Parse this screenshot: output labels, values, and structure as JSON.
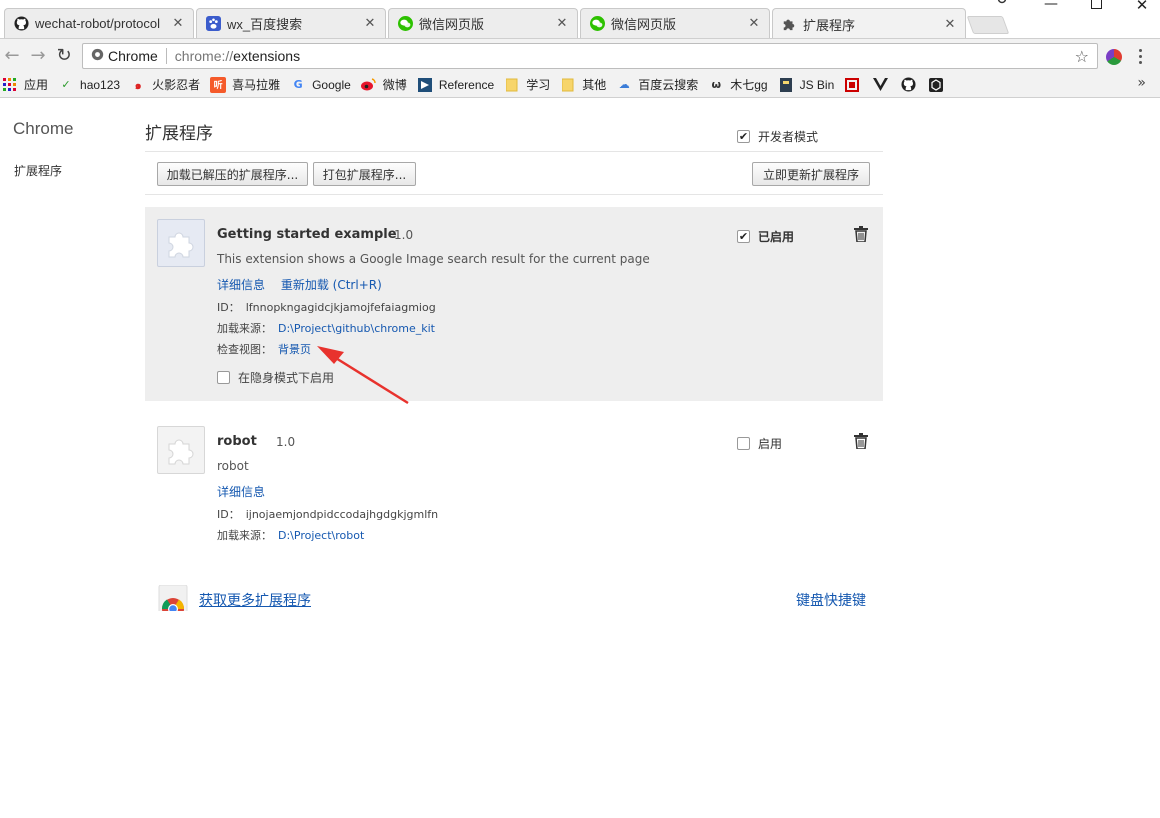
{
  "tabs": [
    {
      "title": "wechat-robot/protocol",
      "icon": "github-icon"
    },
    {
      "title": "wx_百度搜索",
      "icon": "baidu-paw-icon"
    },
    {
      "title": "微信网页版",
      "icon": "wechat-icon"
    },
    {
      "title": "微信网页版",
      "icon": "wechat-icon"
    },
    {
      "title": "扩展程序",
      "icon": "puzzle-icon"
    }
  ],
  "toolbar": {
    "site": "Chrome",
    "url_scheme": "chrome://",
    "url_path": "extensions"
  },
  "bookmarks": [
    {
      "label": "应用",
      "icon": "apps-grid-icon"
    },
    {
      "label": "hao123",
      "icon": "hao123-icon"
    },
    {
      "label": "火影忍者",
      "icon": "naruto-swirl-icon"
    },
    {
      "label": "喜马拉雅",
      "icon": "ximalaya-icon"
    },
    {
      "label": "Google",
      "icon": "google-icon"
    },
    {
      "label": "微博",
      "icon": "weibo-icon"
    },
    {
      "label": "Reference",
      "icon": "reference-icon"
    },
    {
      "label": "学习",
      "icon": "folder-icon"
    },
    {
      "label": "其他",
      "icon": "folder-icon"
    },
    {
      "label": "百度云搜索",
      "icon": "baidu-cloud-icon"
    },
    {
      "label": "木七gg",
      "icon": "muqi-icon"
    },
    {
      "label": "JS Bin",
      "icon": "jsbin-icon"
    },
    {
      "label": "",
      "icon": "red-seal-icon"
    },
    {
      "label": "",
      "icon": "vue-icon"
    },
    {
      "label": "",
      "icon": "github-icon"
    },
    {
      "label": "",
      "icon": "hex-icon"
    }
  ],
  "sidebar": {
    "title": "Chrome",
    "item": "扩展程序"
  },
  "header": {
    "title": "扩展程序",
    "devmode_label": "开发者模式"
  },
  "actions": {
    "load_unpacked": "加载已解压的扩展程序...",
    "pack": "打包扩展程序...",
    "update": "立即更新扩展程序"
  },
  "extensions": [
    {
      "name": "Getting started example",
      "version": "1.0",
      "description": "This extension shows a Google Image search result for the current page",
      "details_link": "详细信息",
      "reload_link": "重新加载 (Ctrl+R)",
      "id_label": "ID：",
      "id": "lfnnopkngagidcjkjamojfefaiagmiog",
      "source_label": "加载来源：",
      "source": "D:\\Project\\github\\chrome_kit",
      "views_label": "检查视图：",
      "views_link": "背景页",
      "incognito_label": "在隐身模式下启用",
      "enabled_label": "已启用"
    },
    {
      "name": "robot",
      "version": "1.0",
      "description": "robot",
      "details_link": "详细信息",
      "id_label": "ID：",
      "id": "ijnojaemjondpidccodajhgdgkjgmlfn",
      "source_label": "加载来源：",
      "source": "D:\\Project\\robot",
      "enabled_label": "启用"
    }
  ],
  "footer": {
    "get_more": "获取更多扩展程序",
    "shortcuts": "键盘快捷键"
  }
}
